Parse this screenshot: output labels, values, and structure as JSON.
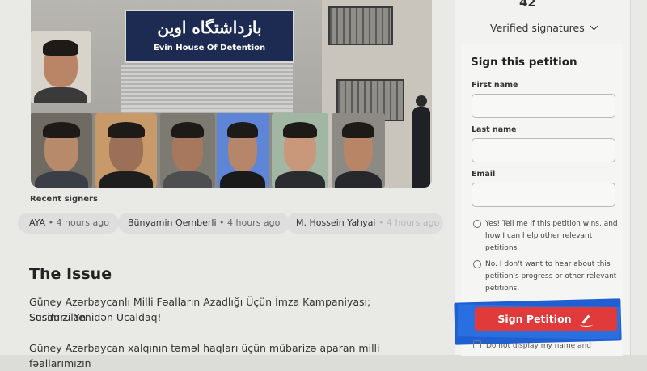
{
  "collage": {
    "sign_persian": "بازداشتگاه اوین",
    "sign_english": "Evin House Of Detention"
  },
  "recent": {
    "label": "Recent signers",
    "signers": [
      {
        "name": "AYA",
        "time": "• 4 hours ago"
      },
      {
        "name": "Bünyamin Qemberli",
        "time": "• 4 hours ago"
      },
      {
        "name": "M. Hossein Yahyai",
        "time": "• 4 hours ago"
      }
    ]
  },
  "issue": {
    "title": "The Issue",
    "paragraph1": "Güney Azərbaycanlı Milli Fəalların Azadlığı Üçün İmza Kampaniyası; Susdurulan",
    "paragraph1b": "Səsimizi Yenidən Ucaldaq!",
    "paragraph2": "Güney Azərbaycan xalqının təməl haqları üçün mübarizə aparan milli fəallarımızın"
  },
  "sidebar": {
    "count": "42",
    "verified": "Verified signatures",
    "form_title": "Sign this petition",
    "first_name_label": "First name",
    "last_name_label": "Last name",
    "email_label": "Email",
    "option_yes": "Yes! Tell me if this petition wins, and how I can help other relevant petitions",
    "option_no": "No. I don't want to hear about this petition's progress or other relevant petitions.",
    "button": "Sign Petition",
    "display_checkbox": "Do not display my name and"
  },
  "colors": {
    "button": "#e03a3a",
    "highlight": "#1f5fd1"
  }
}
